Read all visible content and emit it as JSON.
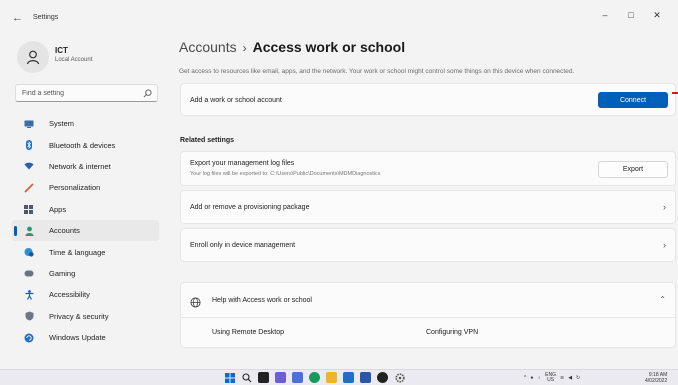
{
  "window": {
    "title": "Settings",
    "controls": [
      "–",
      "□",
      "✕"
    ]
  },
  "profile": {
    "name": "ICT",
    "account_type": "Local Account"
  },
  "search": {
    "placeholder": "Find a setting"
  },
  "sidebar": {
    "items": [
      {
        "label": "System",
        "icon": "system-icon",
        "active": false
      },
      {
        "label": "Bluetooth & devices",
        "icon": "bluetooth-icon",
        "active": false
      },
      {
        "label": "Network & internet",
        "icon": "network-icon",
        "active": false
      },
      {
        "label": "Personalization",
        "icon": "brush-icon",
        "active": false
      },
      {
        "label": "Apps",
        "icon": "apps-icon",
        "active": false
      },
      {
        "label": "Accounts",
        "icon": "accounts-icon",
        "active": true
      },
      {
        "label": "Time & language",
        "icon": "globe-clock-icon",
        "active": false
      },
      {
        "label": "Gaming",
        "icon": "gamepad-icon",
        "active": false
      },
      {
        "label": "Accessibility",
        "icon": "accessibility-icon",
        "active": false
      },
      {
        "label": "Privacy & security",
        "icon": "shield-icon",
        "active": false
      },
      {
        "label": "Windows Update",
        "icon": "update-icon",
        "active": false
      }
    ]
  },
  "main": {
    "breadcrumb_parent": "Accounts",
    "breadcrumb_separator": "›",
    "page_title": "Access work or school",
    "description": "Get access to resources like email, apps, and the network. Your work or school might control some things on this device when connected.",
    "add_account": {
      "label": "Add a work or school account",
      "button": "Connect"
    },
    "related_settings_label": "Related settings",
    "export_logs": {
      "label": "Export your management log files",
      "sublabel": "Your log files will be exported to: C:\\Users\\Public\\Documents\\MDMDiagnostics",
      "button": "Export"
    },
    "provisioning": {
      "label": "Add or remove a provisioning package"
    },
    "mdm_enroll": {
      "label": "Enroll only in device management"
    },
    "help": {
      "label": "Help with Access work or school",
      "links": [
        "Using Remote Desktop",
        "Configuring VPN"
      ]
    }
  },
  "taskbar": {
    "lang_top": "ENG",
    "lang_bottom": "US",
    "time": "9:18 AM",
    "date": "4/02/2022"
  },
  "colors": {
    "accent": "#005fb8",
    "background": "#f3f3f3",
    "card": "#fbfbfb"
  }
}
